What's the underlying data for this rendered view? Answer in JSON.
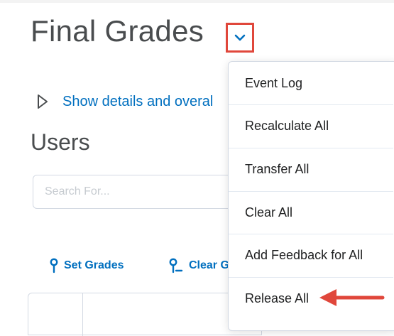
{
  "page": {
    "title": "Final Grades",
    "details_link": "Show details and overal",
    "section_heading": "Users"
  },
  "search": {
    "placeholder": "Search For..."
  },
  "actions": {
    "set_grades": "Set Grades",
    "clear_grades": "Clear G"
  },
  "dropdown": {
    "items": [
      {
        "label": "Event Log"
      },
      {
        "label": "Recalculate All"
      },
      {
        "label": "Transfer All"
      },
      {
        "label": "Clear All"
      },
      {
        "label": "Add Feedback for All"
      },
      {
        "label": "Release All"
      }
    ]
  },
  "colors": {
    "link": "#006fbf",
    "highlight": "#e0473b",
    "heading": "#494c4e"
  },
  "icons": {
    "dropdown_toggle": "chevron-down-icon",
    "details_toggle": "triangle-right-icon",
    "set_grades": "pin-icon",
    "clear_grades": "pin-minus-icon",
    "callout": "arrow-left-icon"
  }
}
